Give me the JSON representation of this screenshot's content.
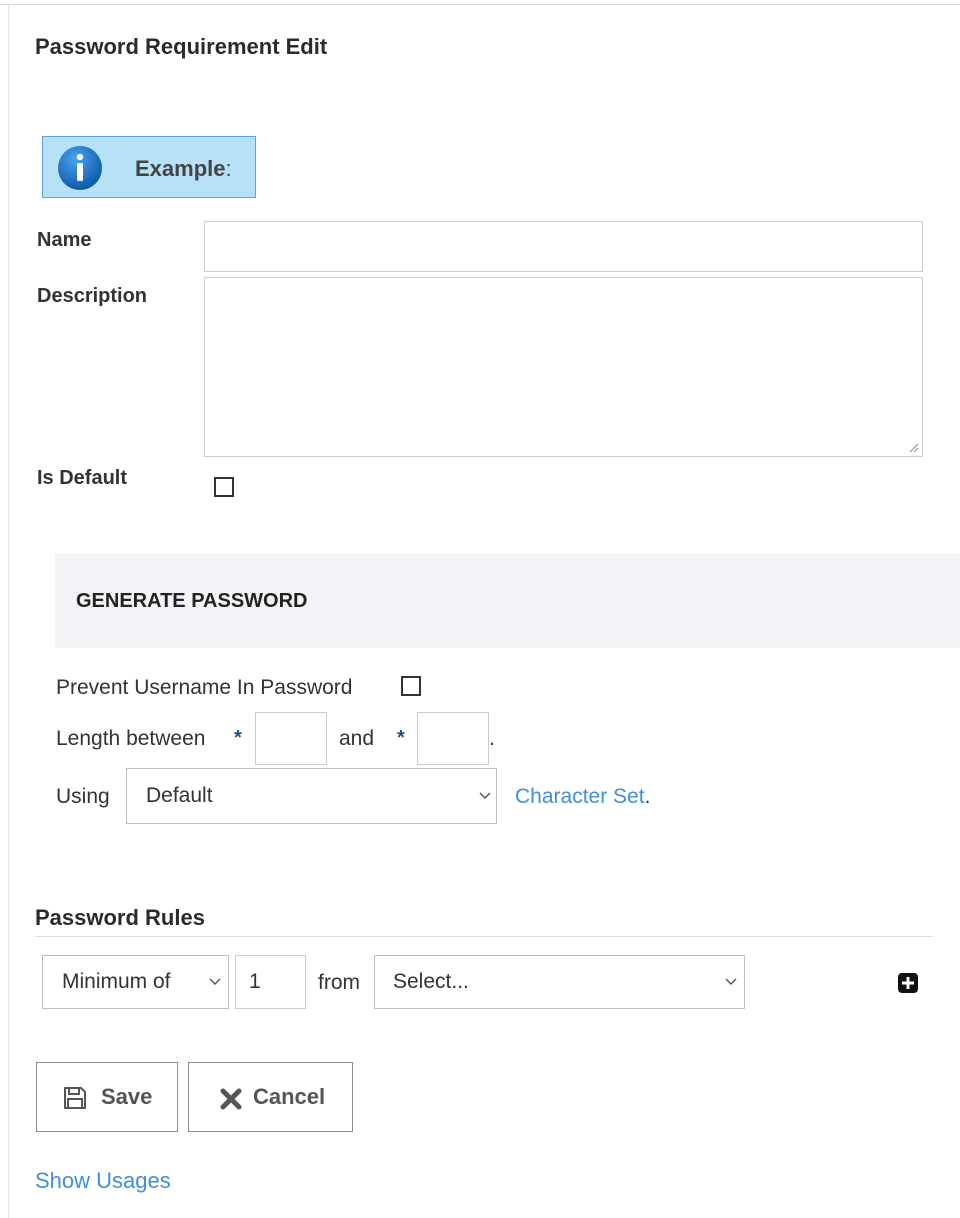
{
  "page": {
    "title": "Password Requirement Edit"
  },
  "info_box": {
    "label": "Example",
    "colon": ":",
    "icon": "info-icon",
    "colors": {
      "background": "#b7e1f7",
      "border": "#5aa6d6",
      "icon": "#1b6fc4"
    }
  },
  "form": {
    "name_label": "Name",
    "name_value": "",
    "description_label": "Description",
    "description_value": "",
    "is_default_label": "Is Default",
    "is_default_checked": false
  },
  "generate_password": {
    "section_title": "GENERATE PASSWORD",
    "prevent_username_label": "Prevent Username In Password",
    "prevent_username_checked": false,
    "length_label": "Length between",
    "required_marker": "*",
    "length_min_value": "",
    "and_label": "and",
    "length_max_value": "",
    "length_suffix": ".",
    "using_label": "Using",
    "using_selected": "Default",
    "character_set_link": "Character Set",
    "character_set_suffix": "."
  },
  "password_rules": {
    "title": "Password Rules",
    "rule": {
      "mode_selected": "Minimum of",
      "count_value": "1",
      "from_label": "from",
      "source_selected": "Select..."
    },
    "add_icon": "plus-square-icon"
  },
  "actions": {
    "save_label": "Save",
    "save_icon": "floppy-disk-icon",
    "cancel_label": "Cancel",
    "cancel_icon": "x-icon",
    "show_usages_link": "Show Usages"
  },
  "colors": {
    "link": "#3f8fd8",
    "required_star": "#1f4f8f",
    "section_band": "#f3f4f7"
  }
}
